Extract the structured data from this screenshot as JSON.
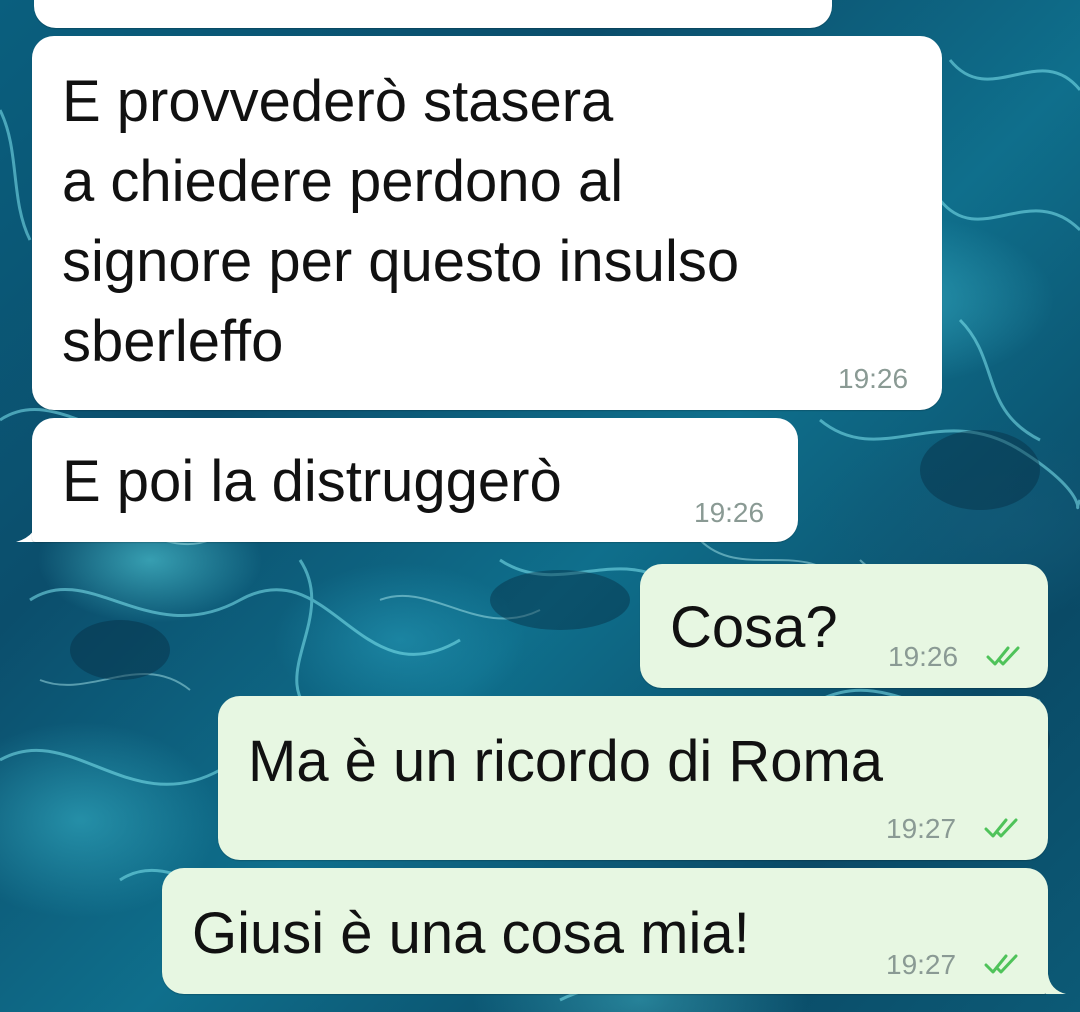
{
  "chat": {
    "messages": [
      {
        "direction": "incoming",
        "text": "E provvederò stasera\na chiedere perdono al\nsignore per questo insulso\nsberleffo",
        "time": "19:26"
      },
      {
        "direction": "incoming",
        "text": "E poi la distruggerò",
        "time": "19:26"
      },
      {
        "direction": "outgoing",
        "text": "Cosa?",
        "time": "19:26",
        "status": "read"
      },
      {
        "direction": "outgoing",
        "text": "Ma è un ricordo di Roma",
        "time": "19:27",
        "status": "read"
      },
      {
        "direction": "outgoing",
        "text": "Giusi è una cosa mia!",
        "time": "19:27",
        "status": "read"
      }
    ]
  },
  "colors": {
    "incoming_bubble": "#ffffff",
    "outgoing_bubble": "#e7f7e2",
    "read_ticks": "#4fc35a",
    "timestamp": "#8a9a94"
  },
  "icons": {
    "read_status": "double-check-icon"
  }
}
